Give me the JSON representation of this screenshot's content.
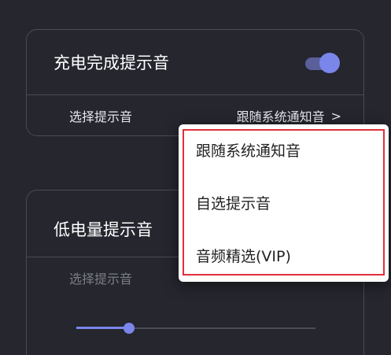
{
  "card_charge": {
    "title": "充电完成提示音",
    "toggle_on": true,
    "select_label": "选择提示音",
    "select_value": "跟随系统通知音",
    "chevron": ">"
  },
  "card_low_battery": {
    "title": "低电量提示音",
    "select_label": "选择提示音",
    "volume_level": 0.22
  },
  "dropdown": {
    "options": [
      {
        "label": "跟随系统通知音"
      },
      {
        "label": "自选提示音"
      },
      {
        "label": "音频精选(VIP)"
      }
    ]
  },
  "colors": {
    "background": "#25262e",
    "accent": "#7b86ea",
    "highlight_border": "#e0303a"
  }
}
